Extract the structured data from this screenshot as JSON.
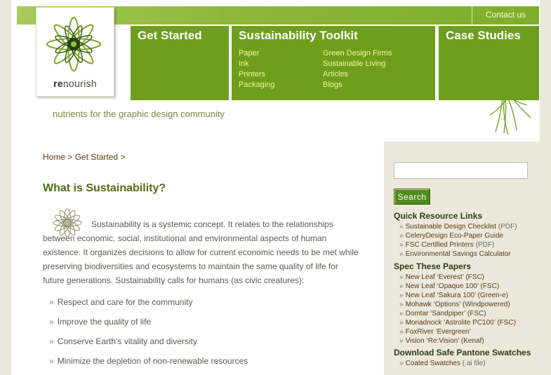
{
  "header": {
    "contact": "Contact us",
    "logo_text_bold": "re",
    "logo_text_rest": "nourish",
    "tagline": "nutrients for the graphic design community",
    "nav": [
      {
        "title": "Get Started",
        "links": []
      },
      {
        "title": "Sustainability Toolkit",
        "links_left": [
          "Paper",
          "Ink",
          "Printers",
          "Packaging"
        ],
        "links_right": [
          "Green Design Firms",
          "Sustainable Living",
          "Articles",
          "Blogs"
        ]
      },
      {
        "title": "Case Studies",
        "links": []
      }
    ]
  },
  "breadcrumb": {
    "home": "Home",
    "current": "Get Started",
    "sep": ">"
  },
  "article": {
    "title": "What is Sustainability?",
    "paragraph": "Sustainability is a systemic concept. It relates to the relationships between economic, social, institutional and environmental aspects of human existence. It organizes decisions to allow for current economic needs to be met while preserving biodiversities and ecosystems to maintain the same quality of life for future generations. Sustainability calls for humans (as civic creatures):",
    "bullets": [
      "Respect and care for the community",
      "Improve the quality of life",
      "Conserve Earth’s vitality and diversity",
      "Minimize the depletion of non-renewable resources"
    ]
  },
  "sidebar": {
    "search_button": "Search",
    "search_value": "",
    "sections": [
      {
        "title": "Quick Resource Links",
        "items": [
          {
            "label": "Sustainable Design Checklist",
            "note": "(PDF)"
          },
          {
            "label": "CeleryDesign Eco-Paper Guide",
            "note": ""
          },
          {
            "label": "FSC Certified Printers",
            "note": "(PDF)"
          },
          {
            "label": "Environmental Savings Calculator",
            "note": ""
          }
        ]
      },
      {
        "title": "Spec These Papers",
        "items": [
          {
            "label": "New Leaf ‘Everest’ (FSC)",
            "note": ""
          },
          {
            "label": "New Leaf ‘Opaque 100’ (FSC)",
            "note": ""
          },
          {
            "label": "New Leaf ‘Sakura 100’ (Green-e)",
            "note": ""
          },
          {
            "label": "Mohawk ‘Options’ (Windpowered)",
            "note": ""
          },
          {
            "label": "Domtar ‘Sandpiper’ (FSC)",
            "note": ""
          },
          {
            "label": "Monadnock ‘Astrolite PC100’ (FSC)",
            "note": ""
          },
          {
            "label": "FoxRiver ‘Evergreen’",
            "note": ""
          },
          {
            "label": "Vision ‘Re:Vision’ (Kenaf)",
            "note": ""
          }
        ]
      },
      {
        "title": "Download Safe Pantone Swatches",
        "items": [
          {
            "label": "Coated Swatches",
            "note": "(.ai file)"
          }
        ]
      }
    ]
  },
  "icons": {
    "bullet": "»",
    "logo": "star-flower-logo-icon",
    "article": "flower-icon",
    "grass": "grass-decoration-icon"
  },
  "colors": {
    "nav_green": "#6f9e1d",
    "light_green": "#a9c95a",
    "title_green": "#4f6e12",
    "sidebar_bg": "#ece9dc",
    "link_brown": "#5a3b14"
  }
}
